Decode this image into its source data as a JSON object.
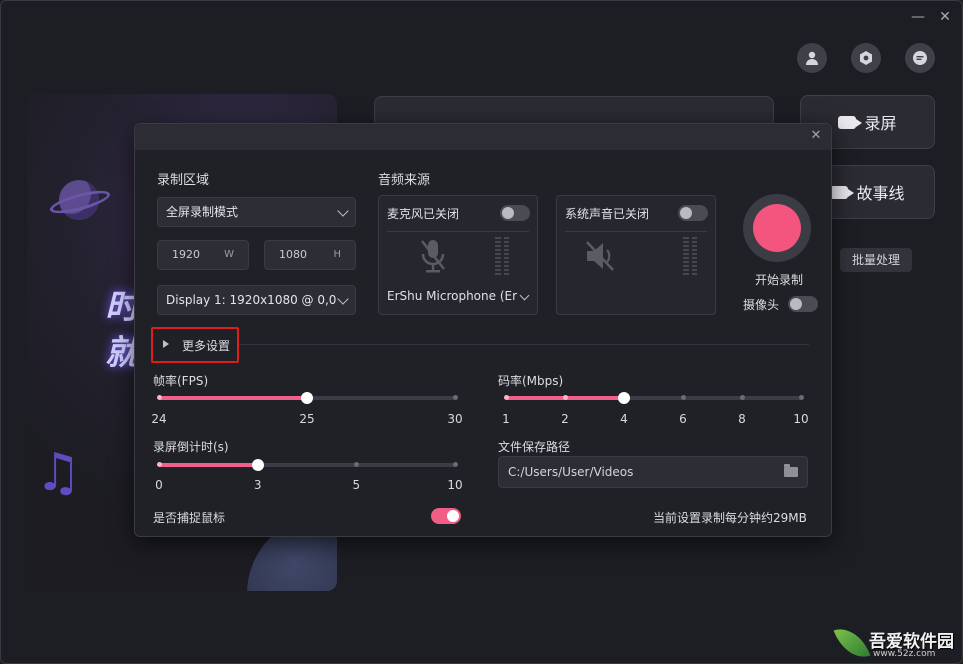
{
  "window": {
    "minimize_glyph": "—",
    "close_glyph": "✕"
  },
  "top_icons": [
    "user-icon",
    "settings-hex-icon",
    "chat-icon"
  ],
  "hero": {
    "line1": "时",
    "line2": "就"
  },
  "side_buttons": {
    "record_screen": "录屏",
    "storyline": "故事线",
    "batch": "批量处理"
  },
  "dialog": {
    "close_glyph": "✕",
    "record_area": {
      "label": "录制区域",
      "mode": "全屏录制模式",
      "width": "1920",
      "width_unit": "W",
      "height": "1080",
      "height_unit": "H",
      "display": "Display 1: 1920x1080 @ 0,0"
    },
    "audio": {
      "label": "音频来源",
      "mic": {
        "title": "麦克风已关闭",
        "on": false,
        "device": "ErShu Microphone (Er"
      },
      "system": {
        "title": "系统声音已关闭",
        "on": false
      }
    },
    "record": {
      "label": "开始录制",
      "camera_label": "摄像头",
      "camera_on": false
    },
    "more_settings": "更多设置",
    "fps": {
      "label": "帧率(FPS)",
      "ticks": [
        "24",
        "25",
        "30"
      ],
      "value": "25"
    },
    "bitrate": {
      "label": "码率(Mbps)",
      "ticks": [
        "1",
        "2",
        "4",
        "6",
        "8",
        "10"
      ],
      "value": "4"
    },
    "countdown": {
      "label": "录屏倒计时(s)",
      "ticks": [
        "0",
        "3",
        "5",
        "10"
      ],
      "value": "3"
    },
    "save_path": {
      "label": "文件保存路径",
      "value": "C:/Users/User/Videos"
    },
    "capture_mouse": {
      "label": "是否捕捉鼠标",
      "on": true
    },
    "estimate": "当前设置录制每分钟约29MB"
  },
  "watermark": {
    "text": "吾爱软件园",
    "url": "www.52z.com"
  },
  "colors": {
    "accent": "#f0608a",
    "highlight": "#e01d1d"
  }
}
